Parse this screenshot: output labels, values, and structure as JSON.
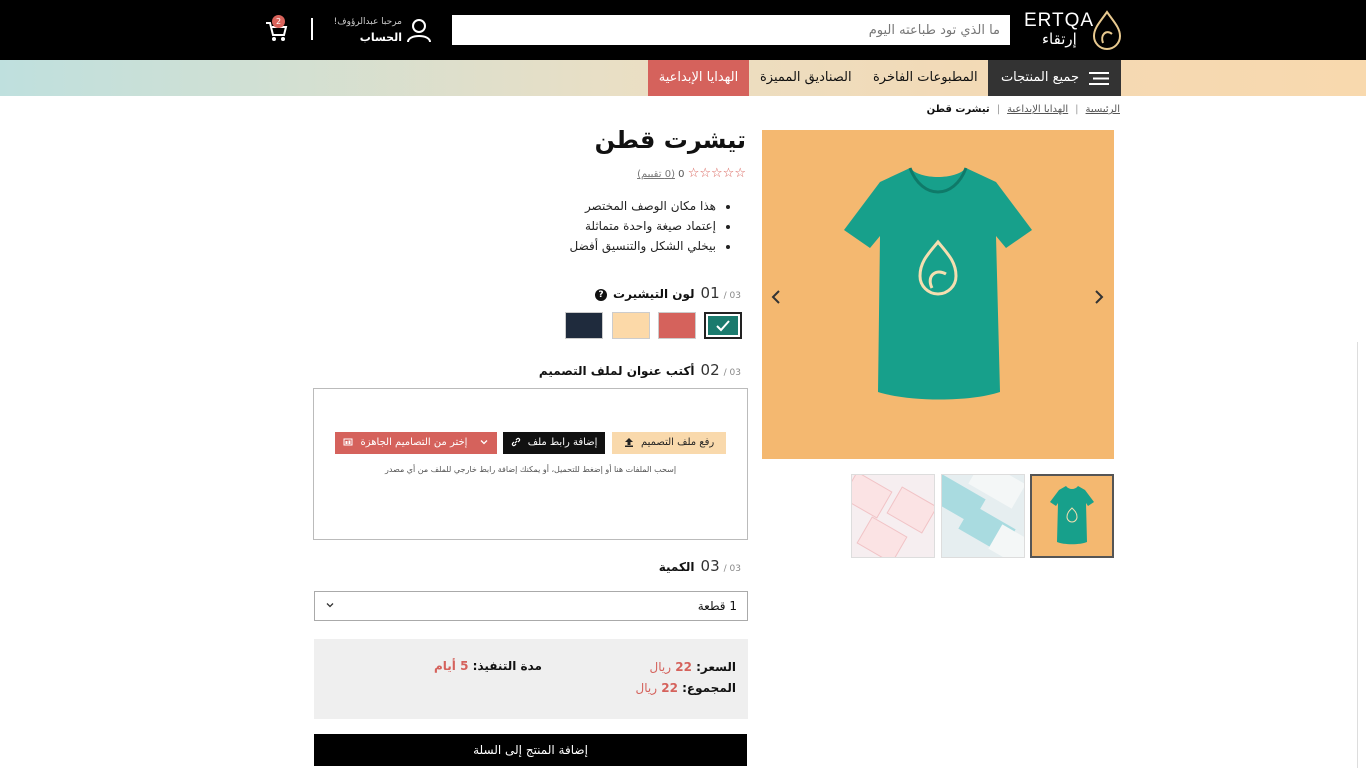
{
  "header": {
    "logo_en": "ERTQA",
    "logo_ar": "إرتقاء",
    "search_placeholder": "ما الذي تود طباعته اليوم",
    "greeting": "مرحبا عبدالرؤوف!",
    "account_label": "الحساب",
    "cart_count": "2"
  },
  "nav": {
    "all_products": "جميع المنتجات",
    "items": [
      "المطبوعات الفاخرة",
      "الصناديق المميزة",
      "الهدايا الإبداعية"
    ]
  },
  "breadcrumb": [
    "الرئيسية",
    "الهدايا الإبداعية",
    "تيشرت قطن"
  ],
  "product": {
    "title": "تيشرت قطن",
    "rating": "0",
    "reviews": "(0 تقييم)",
    "bullets": [
      "هذا مكان الوصف المختصر",
      "إعتماد صيغة واحدة متماثلة",
      "بيخلي الشكل والتنسيق أفضل"
    ]
  },
  "steps": {
    "total": "03 /",
    "color": {
      "num": "01",
      "label": "لون التيشيرت"
    },
    "design": {
      "num": "02",
      "label": "أكتب عنوان لملف التصميم"
    },
    "quantity": {
      "num": "03",
      "label": "الكمية"
    }
  },
  "colors": [
    "#1a7a6d",
    "#d5625c",
    "#fcd9a8",
    "#1f2b3d"
  ],
  "upload": {
    "upload_btn": "رفع ملف التصميم",
    "link_btn": "إضافة رابط ملف",
    "ready_btn": "إختر من التصاميم الجاهزة",
    "hint": "إسحب الملفات هنا أو إضغط للتحميل، أو يمكنك إضافة رابط خارجي للملف من أي مصدر"
  },
  "quantity_value": "1 قطعة",
  "pricing": {
    "price_label": "السعر:",
    "price_value": "22",
    "total_label": "المجموع:",
    "total_value": "22",
    "currency": "ريال",
    "duration_label": "مدة التنفيذ:",
    "duration_value": "5 أيام"
  },
  "add_to_cart": "إضافة المنتج إلى السلة",
  "accent": "#d5625c"
}
